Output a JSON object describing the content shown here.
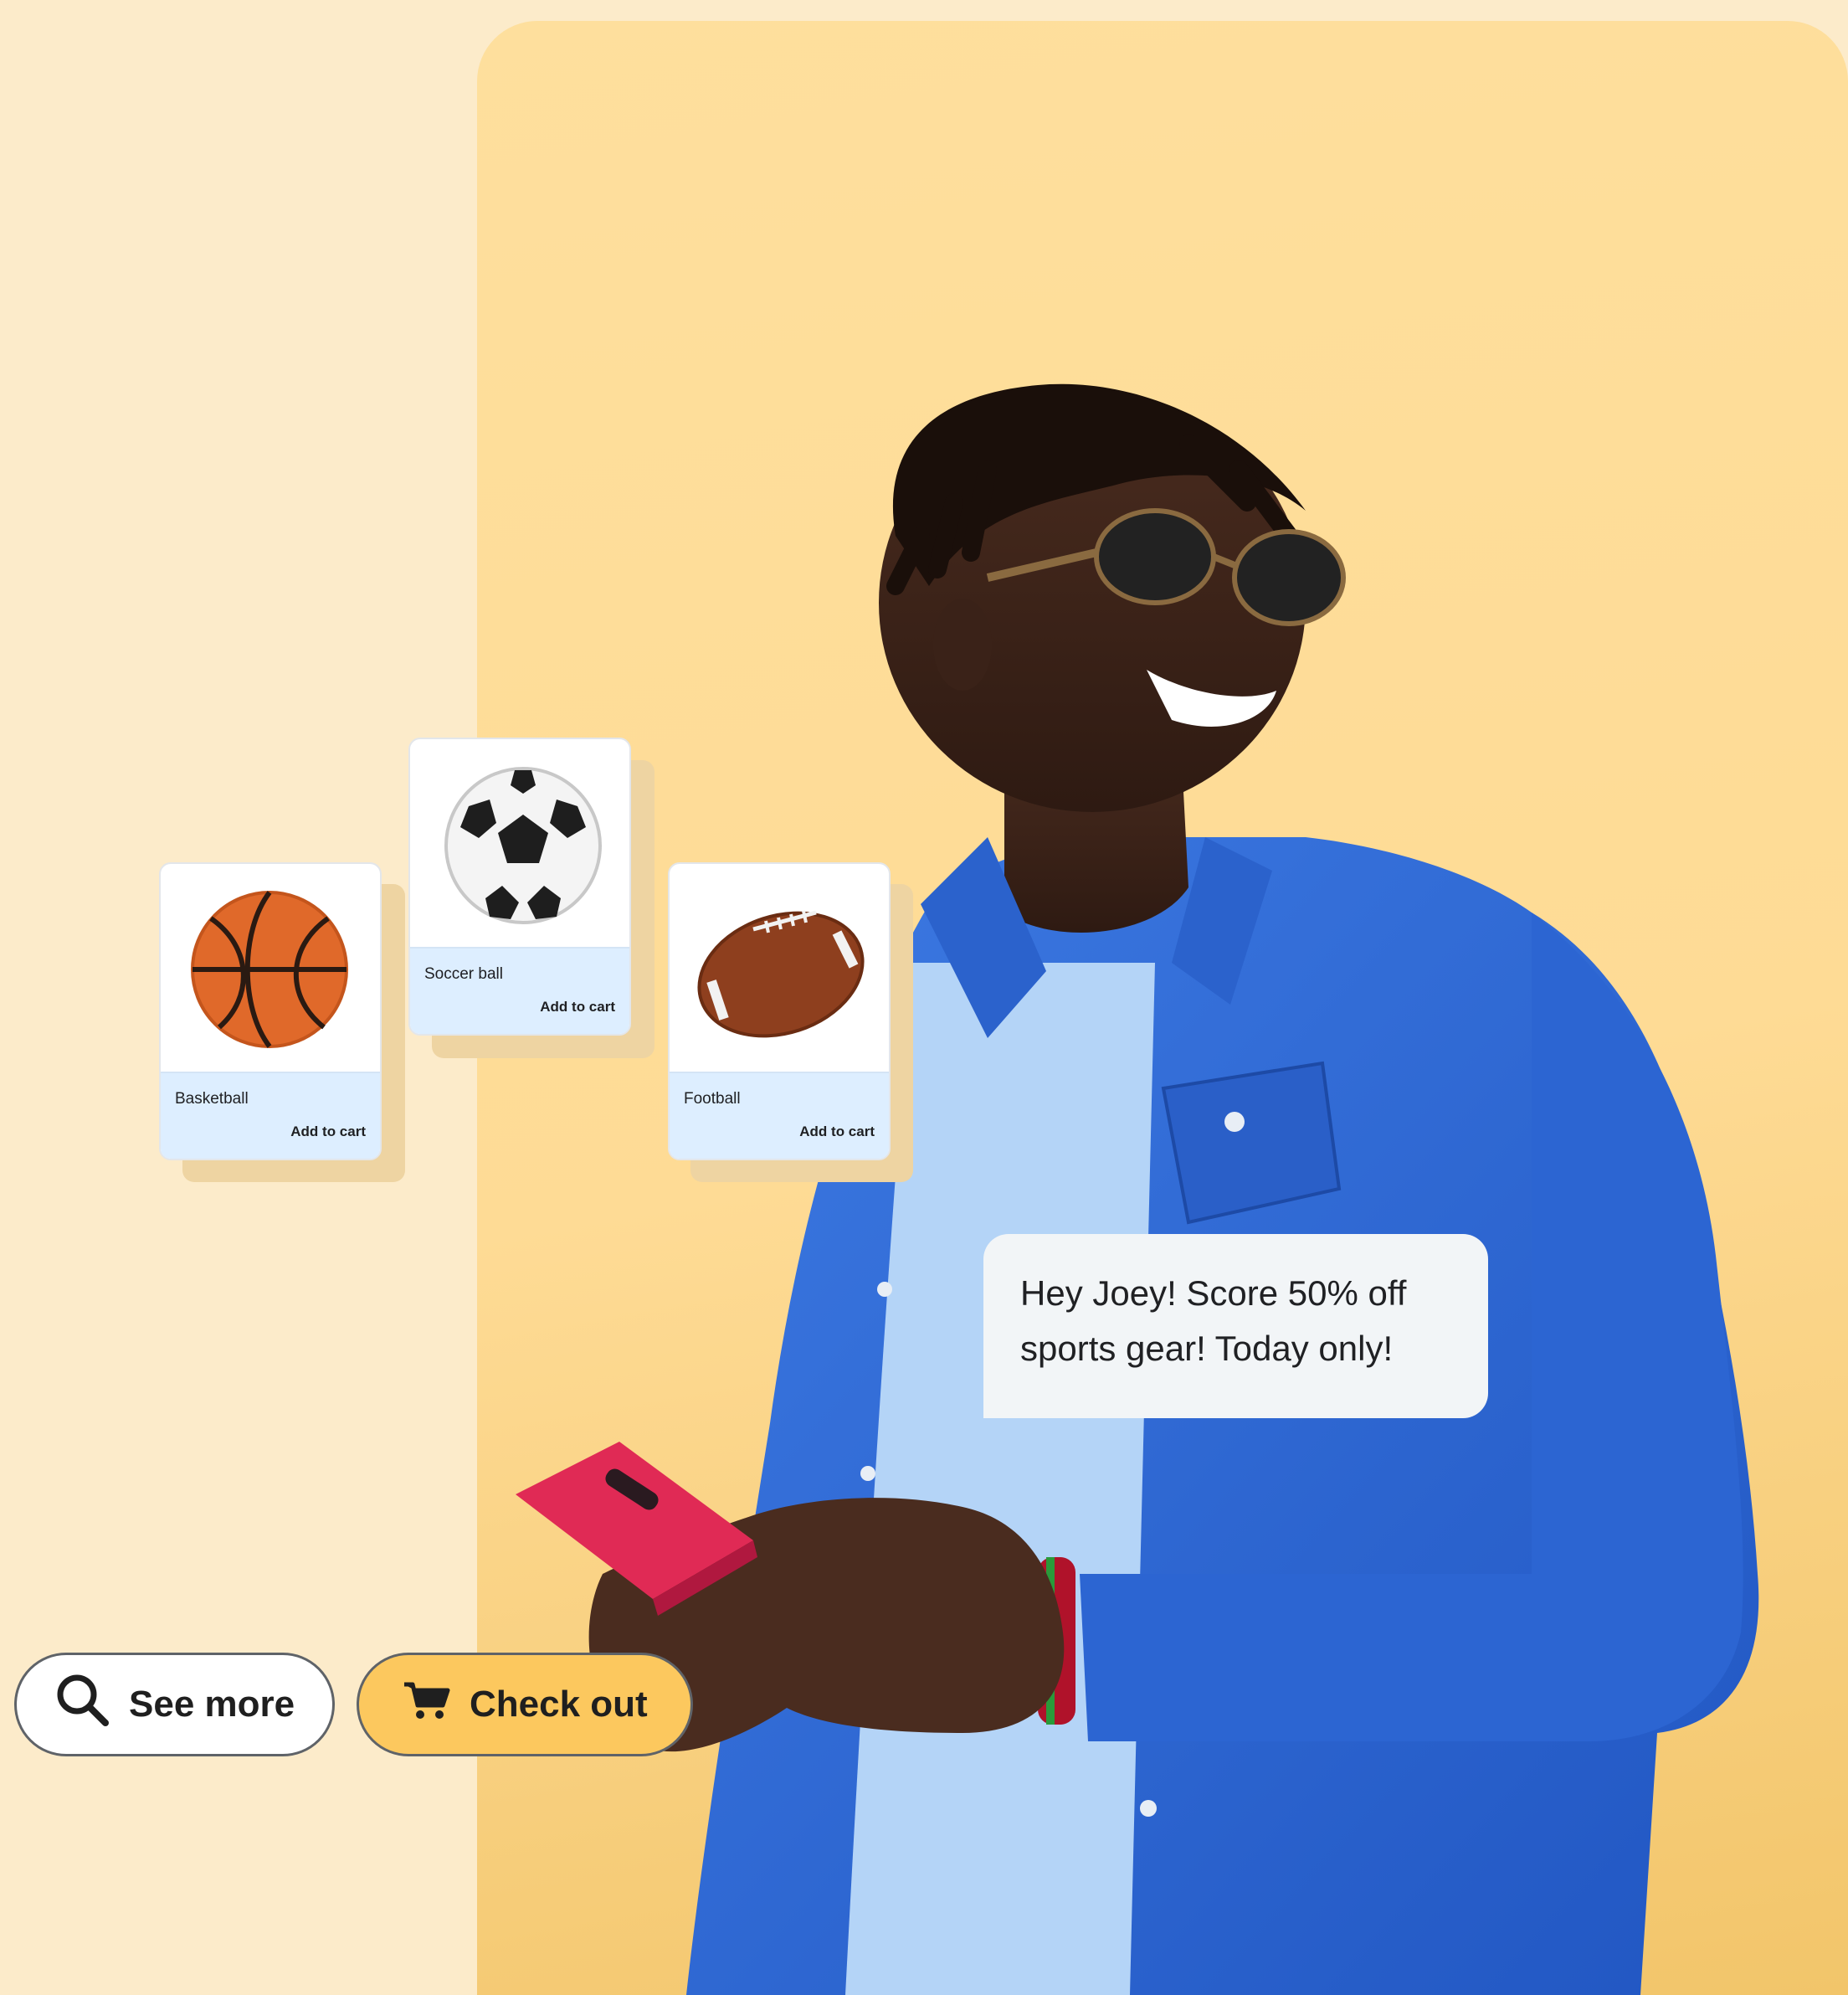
{
  "colors": {
    "page_background": "#fcebca",
    "panel_background": "#fedb95",
    "shirt_blue": "#2f6bd6",
    "card_footer": "#ddeeff",
    "checkout_button": "#fcc85e"
  },
  "products": [
    {
      "name": "Basketball",
      "action": "Add to cart",
      "image": "basketball"
    },
    {
      "name": "Soccer ball",
      "action": "Add to cart",
      "image": "soccer-ball"
    },
    {
      "name": "Football",
      "action": "Add to cart",
      "image": "american-football"
    }
  ],
  "message": {
    "line1": "Hey Joey! Score 50% off",
    "line2": "sports gear! Today only!"
  },
  "buttons": {
    "see_more": {
      "label": "See more",
      "icon": "search-icon"
    },
    "check_out": {
      "label": "Check out",
      "icon": "shopping-cart-icon"
    }
  }
}
